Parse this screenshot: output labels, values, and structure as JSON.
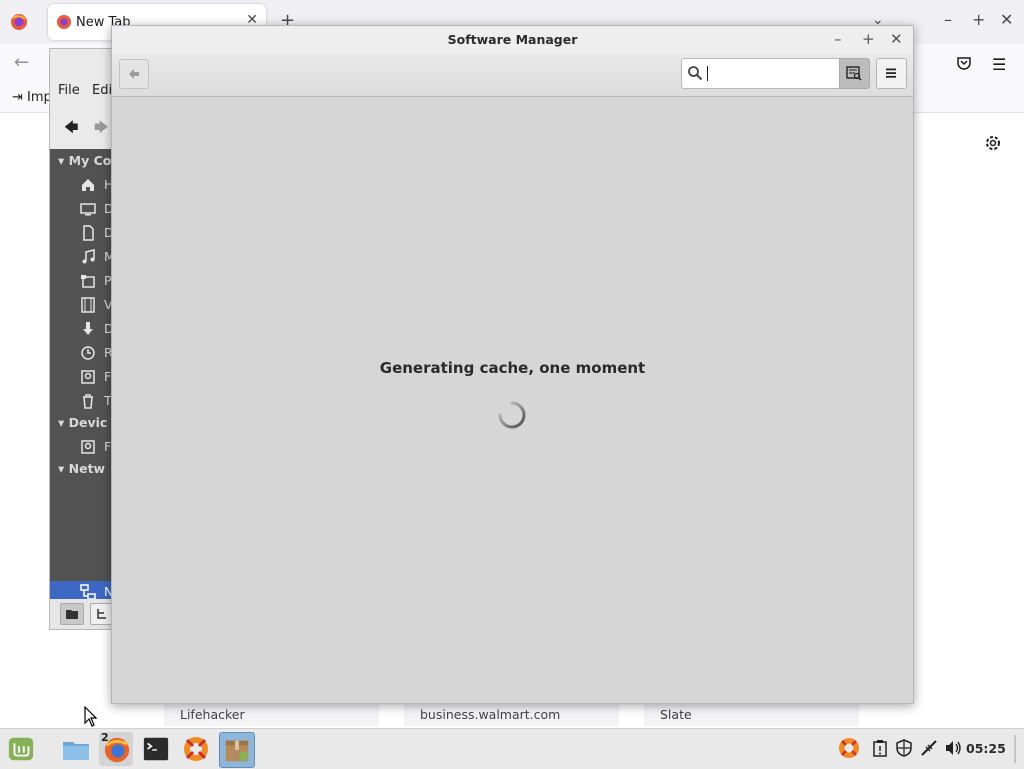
{
  "firefox": {
    "tab_title": "New Tab",
    "import_label": "Imp",
    "top_sites": [
      "Lifehacker",
      "business.walmart.com",
      "Slate"
    ]
  },
  "nemo": {
    "menu": [
      "File",
      "Edi"
    ],
    "sections": [
      "My Co",
      "Devic",
      "Netw"
    ],
    "places": [
      "H",
      "D",
      "D",
      "M",
      "P",
      "V",
      "D",
      "R",
      "F",
      "T"
    ],
    "devices": [
      "F"
    ],
    "network": [
      "N"
    ]
  },
  "software_manager": {
    "title": "Software Manager",
    "search_value": "",
    "status_message": "Generating cache, one moment"
  },
  "taskbar": {
    "firefox_badge": "2",
    "clock": "05:25"
  },
  "colors": {
    "selection": "#3c68c4",
    "mint_green": "#87b158",
    "sidebar_bg": "#525252"
  }
}
